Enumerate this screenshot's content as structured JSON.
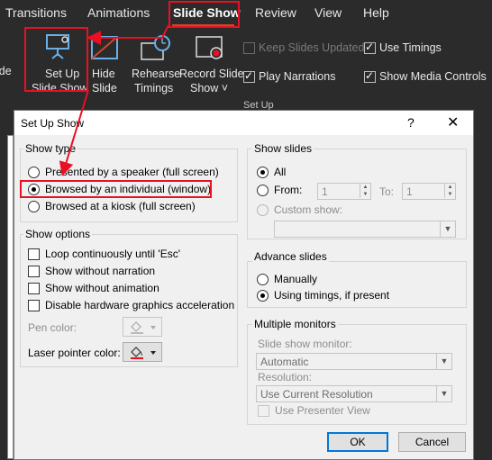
{
  "ribbon": {
    "tabs": [
      "Transitions",
      "Animations",
      "Slide Show",
      "Review",
      "View",
      "Help"
    ],
    "left_cut_label": "ide",
    "buttons": {
      "setup_line1": "Set Up",
      "setup_line2": "Slide Show",
      "hide_line1": "Hide",
      "hide_line2": "Slide",
      "rehearse_line1": "Rehearse",
      "rehearse_line2": "Timings",
      "record_line1": "Record Slide",
      "record_line2": "Show ˅"
    },
    "checks": {
      "keep_updated": "Keep Slides Updated",
      "use_timings": "Use Timings",
      "play_narrations": "Play Narrations",
      "show_media": "Show Media Controls"
    },
    "group_label": "Set Up",
    "accent": "#d24726"
  },
  "dialog": {
    "title": "Set Up Show",
    "help_glyph": "?",
    "close_glyph": "✕",
    "show_type": {
      "title": "Show type",
      "options": [
        "Presented by a speaker (full screen)",
        "Browsed by an individual (window)",
        "Browsed at a kiosk (full screen)"
      ]
    },
    "show_options": {
      "title": "Show options",
      "checks": [
        "Loop continuously until 'Esc'",
        "Show without narration",
        "Show without animation",
        "Disable hardware graphics acceleration"
      ],
      "pen_color": "Pen color:",
      "laser_color": "Laser pointer color:",
      "laser_accent": "#e81123"
    },
    "show_slides": {
      "title": "Show slides",
      "all": "All",
      "from": "From:",
      "to": "To:",
      "from_value": "1",
      "to_value": "1",
      "custom": "Custom show:"
    },
    "advance": {
      "title": "Advance slides",
      "manually": "Manually",
      "timings": "Using timings, if present"
    },
    "monitors": {
      "title": "Multiple monitors",
      "monitor_label": "Slide show monitor:",
      "monitor_value": "Automatic",
      "resolution_label": "Resolution:",
      "resolution_value": "Use Current Resolution",
      "presenter": "Use Presenter View"
    },
    "ok": "OK",
    "cancel": "Cancel"
  },
  "annotation_color": "#e81123"
}
